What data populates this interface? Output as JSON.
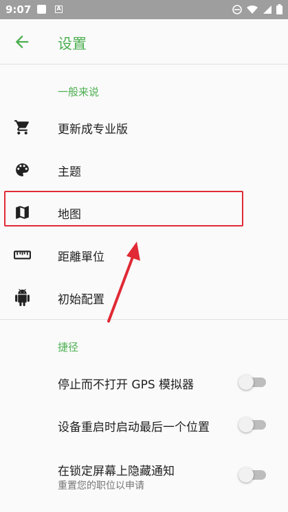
{
  "status_bar": {
    "time": "9:07",
    "badge": "A"
  },
  "app_bar": {
    "title": "设置",
    "back_icon": "arrow-left-icon",
    "accent": "#4caf50"
  },
  "sections": {
    "general": "一般来说",
    "shortcuts": "捷径"
  },
  "general_items": [
    {
      "label": "更新成专业版",
      "icon": "cart-icon"
    },
    {
      "label": "主题",
      "icon": "palette-icon"
    },
    {
      "label": "地图",
      "icon": "map-icon"
    },
    {
      "label": "距離單位",
      "icon": "ruler-icon"
    },
    {
      "label": "初始配置",
      "icon": "android-icon"
    }
  ],
  "shortcut_items": [
    {
      "label": "停止而不打开 GPS 模拟器",
      "enabled": false
    },
    {
      "label": "设备重启时启动最后一个位置",
      "enabled": false
    },
    {
      "label": "在锁定屏幕上隐藏通知",
      "sublabel": "重置您的职位以申请",
      "enabled": false
    }
  ],
  "annotation": {
    "highlight_color": "#e02a35",
    "highlighted_item": "地图"
  }
}
